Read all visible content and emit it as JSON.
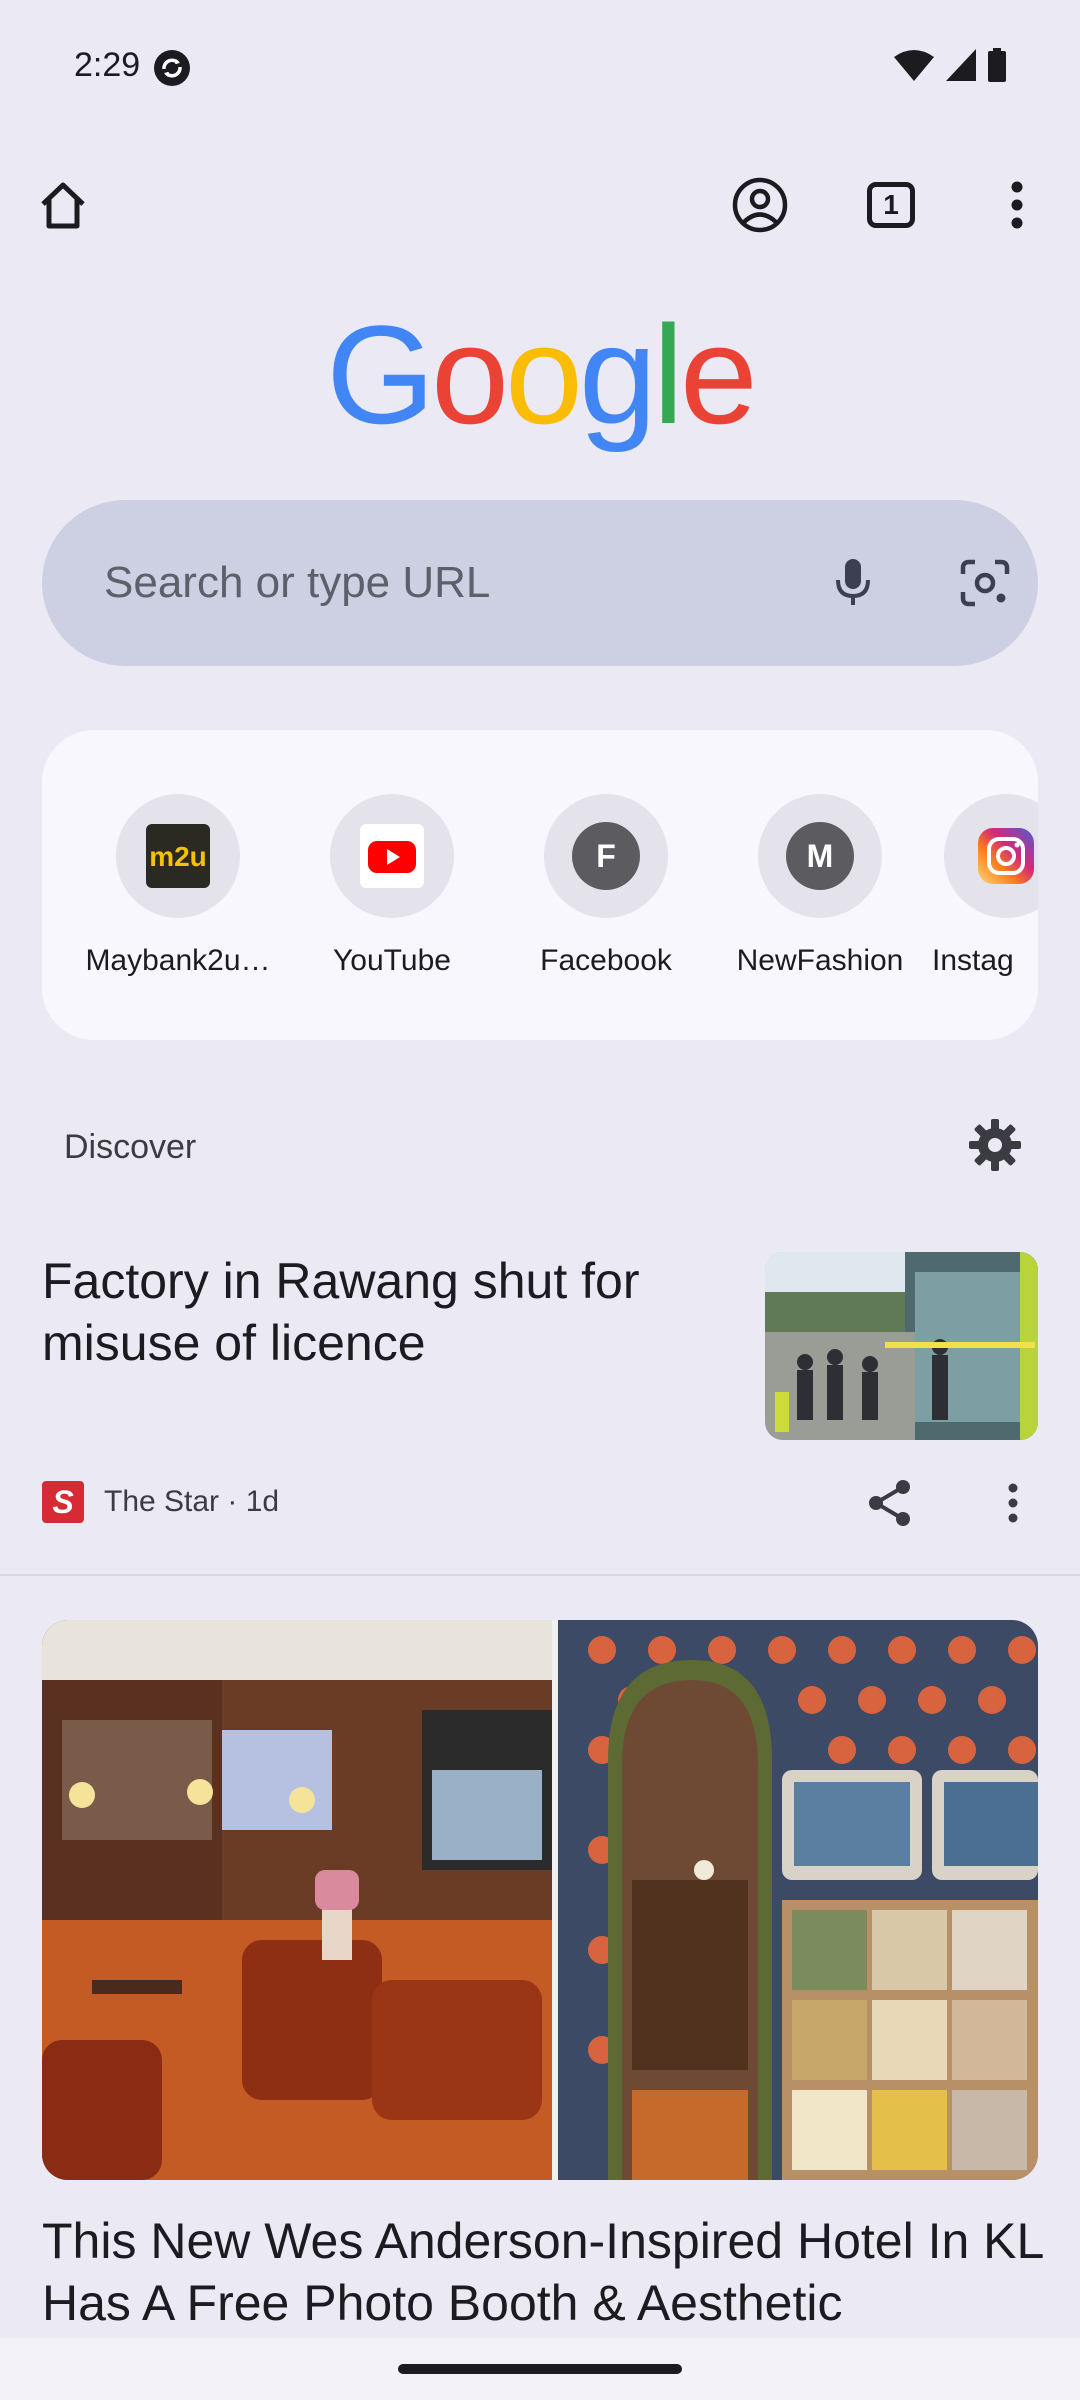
{
  "status_bar": {
    "time": "2:29"
  },
  "toolbar": {
    "tab_count": "1"
  },
  "logo": {
    "letters": [
      {
        "char": "G",
        "color": "#4285F4"
      },
      {
        "char": "o",
        "color": "#EA4335"
      },
      {
        "char": "o",
        "color": "#FBBC05"
      },
      {
        "char": "g",
        "color": "#4285F4"
      },
      {
        "char": "l",
        "color": "#34A853"
      },
      {
        "char": "e",
        "color": "#EA4335"
      }
    ]
  },
  "search": {
    "placeholder": "Search or type URL"
  },
  "shortcuts": [
    {
      "label": "Maybank2u…",
      "icon": "maybank-icon"
    },
    {
      "label": "YouTube",
      "icon": "youtube-icon"
    },
    {
      "label": "Facebook",
      "icon": "letter",
      "letter": "F"
    },
    {
      "label": "NewFashion",
      "icon": "letter",
      "letter": "M"
    },
    {
      "label": "Instag",
      "icon": "instagram-icon"
    }
  ],
  "discover": {
    "label": "Discover"
  },
  "articles": [
    {
      "title": "Factory in Rawang shut for misuse of licence",
      "source_logo": "S",
      "source": "The Star · 1d"
    },
    {
      "title": "This New Wes Anderson-Inspired Hotel In KL Has A Free Photo Booth & Aesthetic"
    }
  ],
  "colors": {
    "background": "#ebeaf4",
    "search_box": "#cdd0e2",
    "shortcut_panel": "#f8f7fd"
  }
}
